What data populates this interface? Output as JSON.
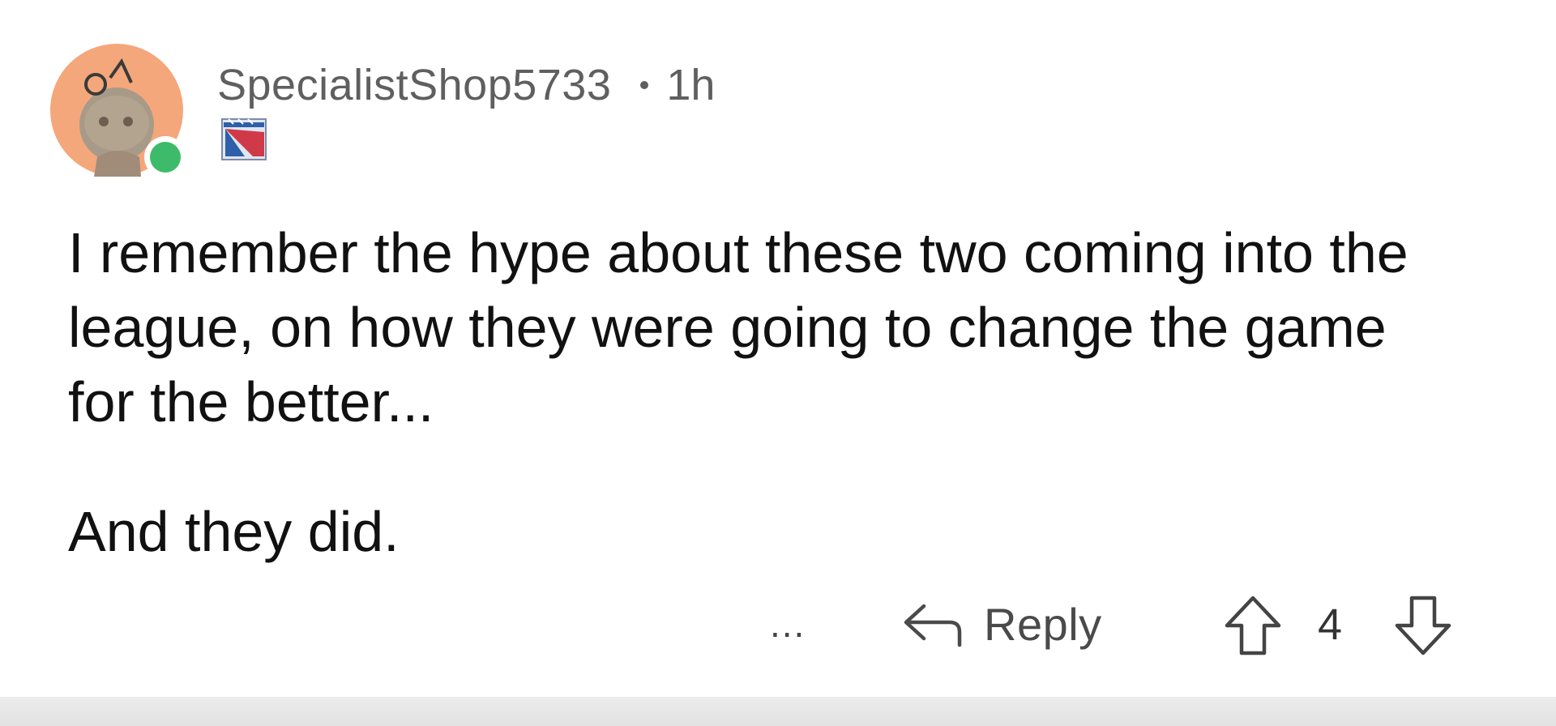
{
  "comment": {
    "username": "SpecialistShop5733",
    "time": "1h",
    "body_lines": [
      "I remember the hype about these two coming into the league, on how they were going to change the game for the better...",
      "And they did."
    ]
  },
  "actions": {
    "more_label": "...",
    "reply_label": "Reply",
    "score": "4"
  },
  "icons": {
    "avatar": "reddit-snoo-avatar",
    "online": "online-status-dot",
    "flair": "team-flair-icon",
    "reply": "reply-arrow-icon",
    "upvote": "upvote-arrow-icon",
    "downvote": "downvote-arrow-icon"
  },
  "colors": {
    "avatar_bg": "#F4A77A",
    "online": "#3DBB6A",
    "text": "#111111",
    "meta": "#5F5F5F"
  }
}
